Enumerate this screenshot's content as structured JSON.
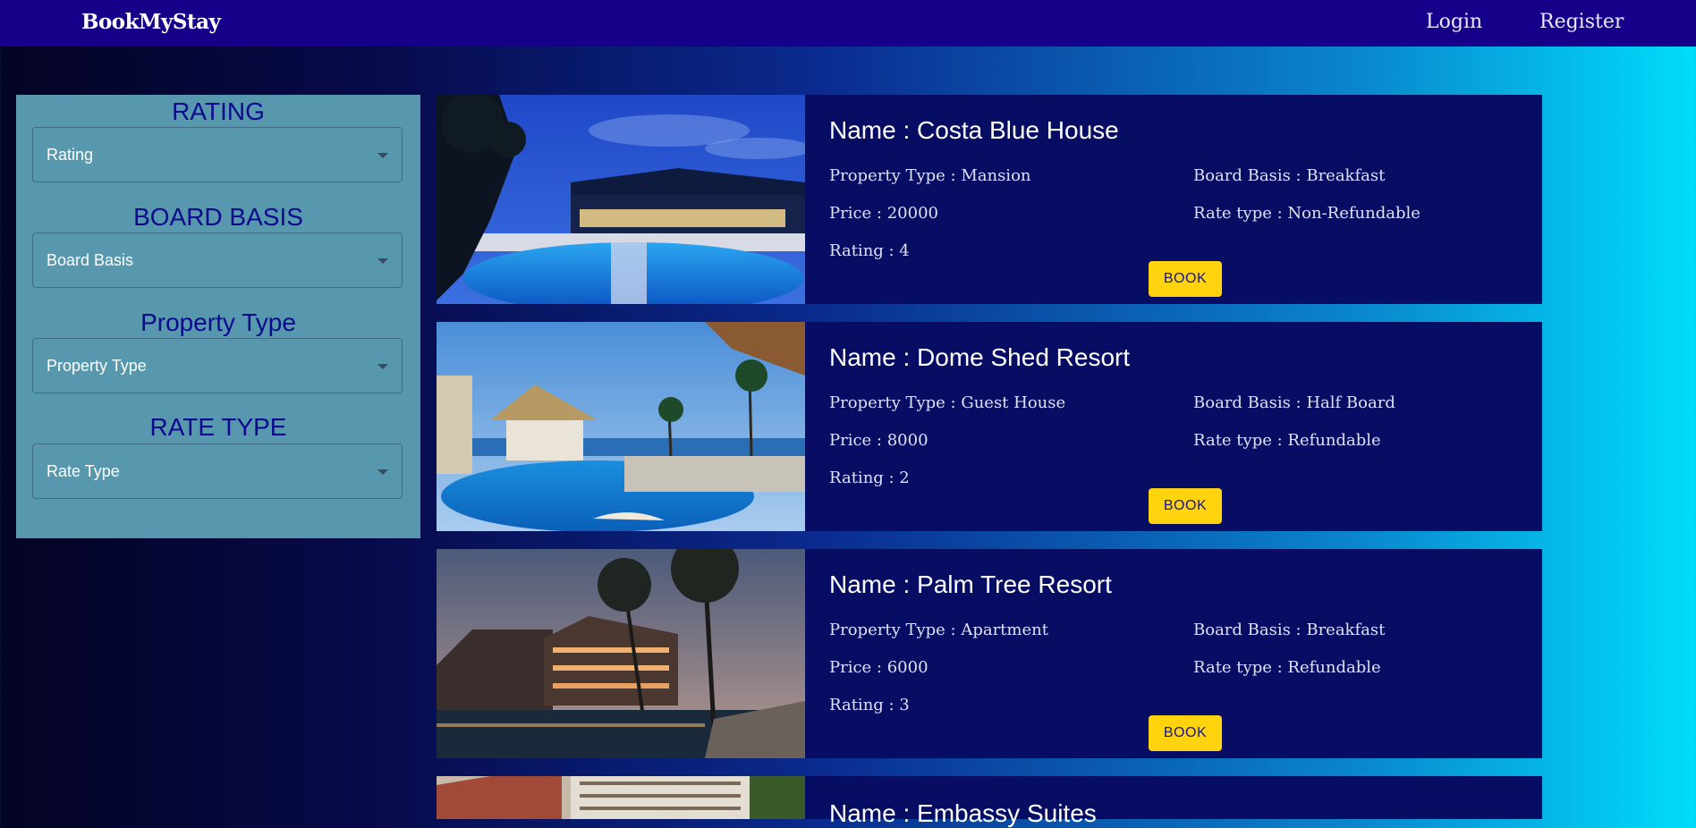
{
  "nav": {
    "brand": "BookMyStay",
    "login": "Login",
    "register": "Register"
  },
  "filters": {
    "rating": {
      "title": "RATING",
      "placeholder": "Rating"
    },
    "board_basis": {
      "title": "BOARD BASIS",
      "placeholder": "Board Basis"
    },
    "property_type": {
      "title": "Property Type",
      "placeholder": "Property Type"
    },
    "rate_type": {
      "title": "RATE TYPE",
      "placeholder": "Rate Type"
    }
  },
  "hotels": [
    {
      "name": "Name : Costa Blue House",
      "property_type": "Property Type : Mansion",
      "board_basis": "Board Basis : Breakfast",
      "price": "Price : 20000",
      "rate_type": "Rate type : Non-Refundable",
      "rating": "Rating : 4",
      "book": "BOOK"
    },
    {
      "name": "Name : Dome Shed Resort",
      "property_type": "Property Type : Guest House",
      "board_basis": "Board Basis : Half Board",
      "price": "Price : 8000",
      "rate_type": "Rate type : Refundable",
      "rating": "Rating : 2",
      "book": "BOOK"
    },
    {
      "name": "Name : Palm Tree Resort",
      "property_type": "Property Type : Apartment",
      "board_basis": "Board Basis : Breakfast",
      "price": "Price : 6000",
      "rate_type": "Rate type : Refundable",
      "rating": "Rating : 3",
      "book": "BOOK"
    },
    {
      "name": "Name : Embassy Suites"
    }
  ],
  "colors": {
    "navbar": "#16008a",
    "card": "#070d63",
    "book_button": "#ffd40f",
    "filter_panel": "#5898ae"
  }
}
